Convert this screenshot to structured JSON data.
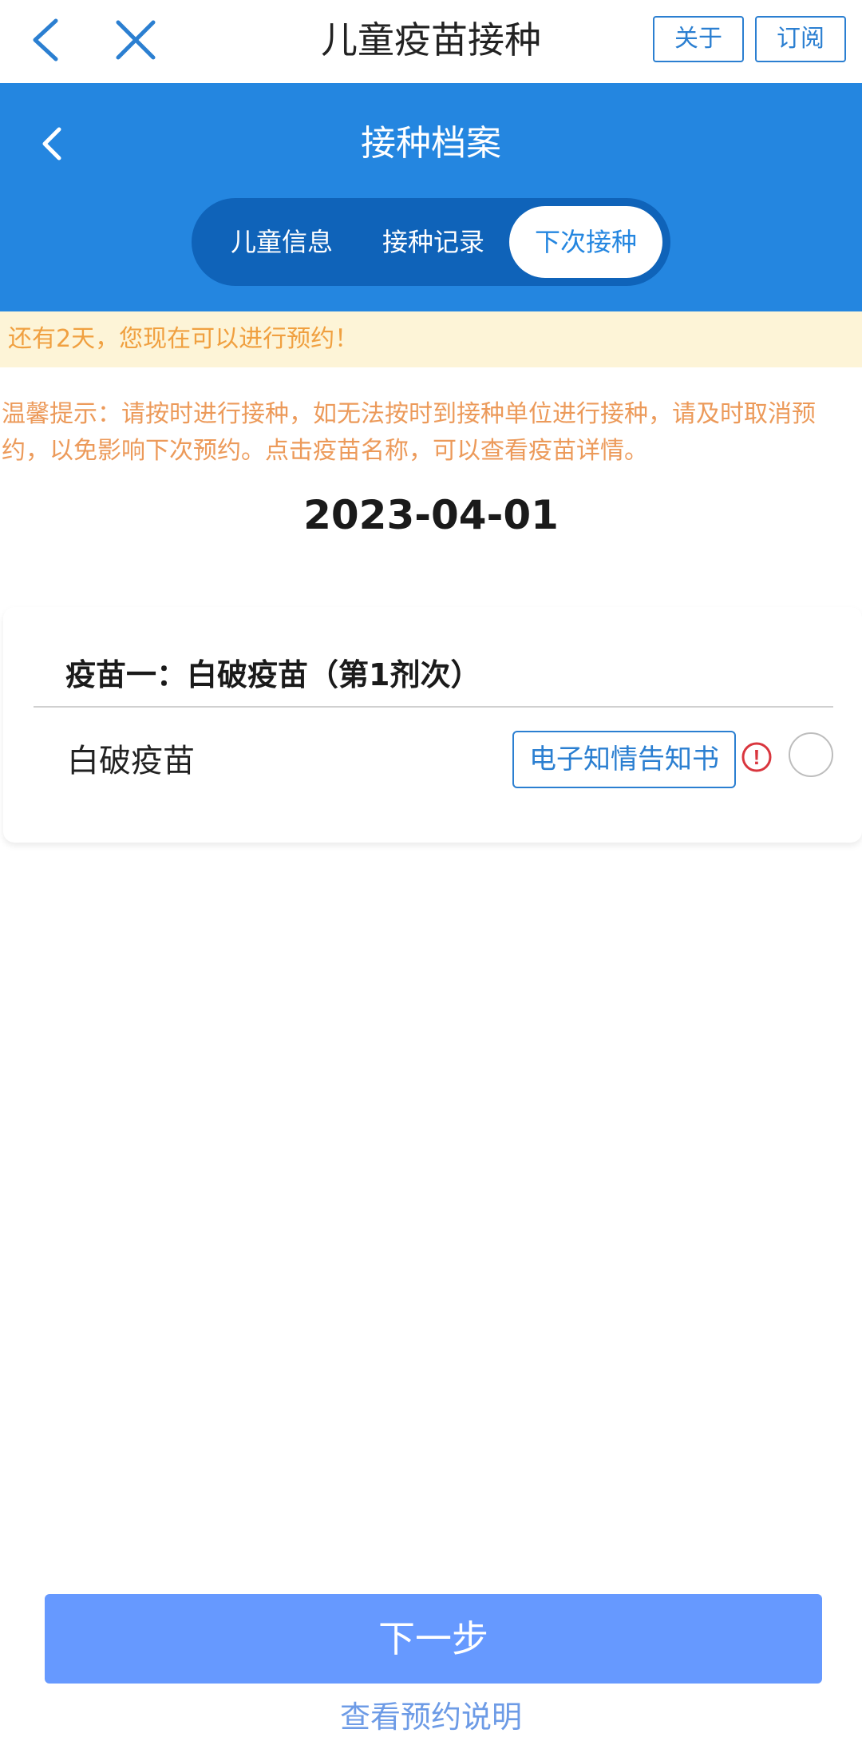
{
  "topbar": {
    "title": "儿童疫苗接种",
    "about_label": "关于",
    "subscribe_label": "订阅"
  },
  "header": {
    "title": "接种档案",
    "tabs": [
      {
        "label": "儿童信息",
        "active": false
      },
      {
        "label": "接种记录",
        "active": false
      },
      {
        "label": "下次接种",
        "active": true
      }
    ]
  },
  "notice": "还有2天，您现在可以进行预约！",
  "tip": "温馨提示：请按时进行接种，如无法按时到接种单位进行接种，请及时取消预约，以免影响下次预约。点击疫苗名称，可以查看疫苗详情。",
  "date": "2023-04-01",
  "vaccine": {
    "heading": "疫苗一：白破疫苗（第1剂次）",
    "name": "白破疫苗",
    "consent_label": "电子知情告知书",
    "warning_symbol": "!"
  },
  "footer": {
    "next_label": "下一步",
    "help_label": "查看预约说明"
  },
  "colors": {
    "primary": "#2486e0",
    "button": "#6699ff",
    "notice_bg": "#fdf4d7",
    "tip_text": "#ec9a5a"
  }
}
